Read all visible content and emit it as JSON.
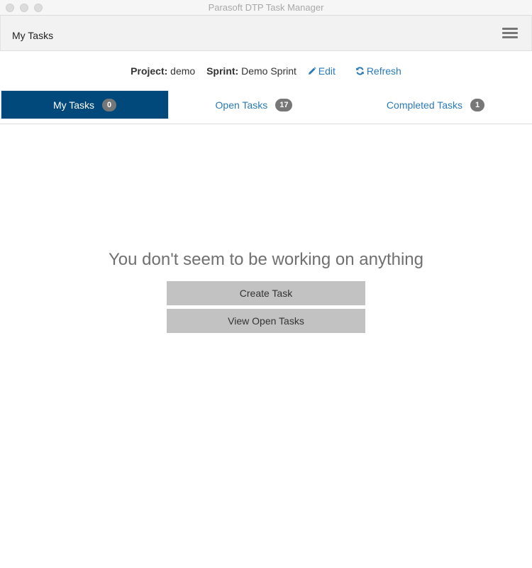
{
  "window": {
    "title": "Parasoft DTP Task Manager",
    "controls": [
      "close-icon",
      "minimize-icon",
      "maximize-icon"
    ]
  },
  "appbar": {
    "title": "My Tasks",
    "menu_icon": "hamburger-menu-icon"
  },
  "info": {
    "project_label": "Project:",
    "project_value": "demo",
    "sprint_label": "Sprint:",
    "sprint_value": "Demo Sprint",
    "edit_label": "Edit",
    "edit_icon": "pencil-icon",
    "refresh_label": "Refresh",
    "refresh_icon": "refresh-icon"
  },
  "tabs": [
    {
      "label": "My Tasks",
      "count": "0",
      "active": true
    },
    {
      "label": "Open Tasks",
      "count": "17",
      "active": false
    },
    {
      "label": "Completed Tasks",
      "count": "1",
      "active": false
    }
  ],
  "empty_state": {
    "message": "You don't seem to be working on anything",
    "create_button": "Create Task",
    "view_button": "View Open Tasks"
  },
  "colors": {
    "accent": "#00497a",
    "link": "#2a7ab8",
    "badge": "#777777",
    "button": "#c2c2c2"
  }
}
